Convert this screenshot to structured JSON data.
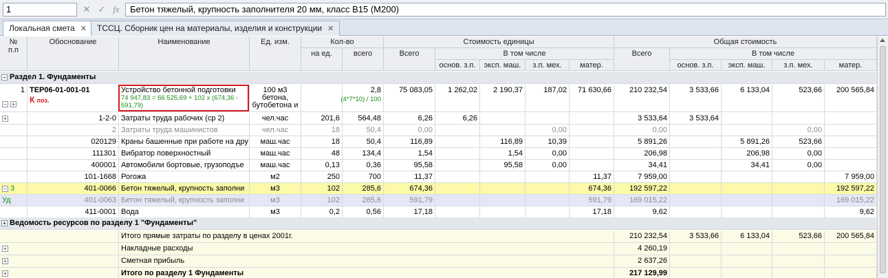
{
  "formula_bar": {
    "cell_ref": "1",
    "cancel_icon": "cancel-icon",
    "accept_icon": "accept-icon",
    "fx_icon": "fx-icon",
    "fx_label": "fx",
    "value": "Бетон тяжелый, крупность заполнителя 20 мм, класс В15 (М200)"
  },
  "tabs": [
    {
      "label": "Локальная смета",
      "close": "✕"
    },
    {
      "label": "ТССЦ. Сборник цен на материалы, изделия и конструкции",
      "close": "✕"
    }
  ],
  "headers": {
    "num": "№",
    "num2": "п.п",
    "basis": "Обоснование",
    "name": "Наименование",
    "unit": "Ед. изм.",
    "qty": "Кол-во",
    "qty_unit": "на ед.",
    "qty_total": "всего",
    "unit_cost": "Стоимость единицы",
    "total": "Всего",
    "incl": "В том числе",
    "osn_zp": "основ. з.п.",
    "eksp_mash": "эксп. маш.",
    "zp_meh": "з.п. мех.",
    "mater": "матер.",
    "total_cost": "Общая стоимость",
    "total2": "Всего",
    "incl2": "В том числе",
    "osn_zp2": "основ. з.п.",
    "eksp_mash2": "эксп. маш.",
    "zp_meh2": "з.п. мех.",
    "mater2": "матер."
  },
  "section1": "Раздел 1. Фундаменты",
  "main_row": {
    "num": "1",
    "code": "ТЕР06-01-001-01",
    "k_label": "К",
    "k_sub": "поз.",
    "name": "Устройство бетонной подготовки",
    "formula": "74 947,83 = 66 525,69 + 102 x (674,36 - 591,79)",
    "unit1": "100 м3",
    "unit2": "бетона,",
    "unit3": "бутобетона и",
    "qty_total": "2,8",
    "qty_formula": "(4*7*10) / 100",
    "u_total": "75 083,05",
    "u_osn": "1 262,02",
    "u_eksp": "2 190,37",
    "u_zpmeh": "187,02",
    "u_mater": "71 630,66",
    "t_total": "210 232,54",
    "t_osn": "3 533,66",
    "t_eksp": "6 133,04",
    "t_zpmeh": "523,66",
    "t_mater": "200 565,84"
  },
  "rows": [
    {
      "type": "plus",
      "bg": "",
      "grey": false,
      "num": "",
      "code": "1-2-0",
      "name": "Затраты труда рабочих (ср 2)",
      "unit": "чел.час",
      "qu": "201,6",
      "qt": "564,48",
      "ut": "6,26",
      "uo": "6,26",
      "ue": "",
      "uz": "",
      "um": "",
      "tt": "3 533,64",
      "to": "3 533,64",
      "te": "",
      "tz": "",
      "tm": ""
    },
    {
      "type": "",
      "bg": "",
      "grey": true,
      "num": "",
      "code": "2",
      "name": "Затраты труда машинистов",
      "unit": "чел.час",
      "qu": "18",
      "qt": "50,4",
      "ut": "0,00",
      "uo": "",
      "ue": "",
      "uz": "0,00",
      "um": "",
      "tt": "0,00",
      "to": "",
      "te": "",
      "tz": "0,00",
      "tm": ""
    },
    {
      "type": "",
      "bg": "",
      "grey": false,
      "num": "",
      "code": "020129",
      "name": "Краны башенные при работе на дру",
      "unit": "маш.час",
      "qu": "18",
      "qt": "50,4",
      "ut": "116,89",
      "uo": "",
      "ue": "116,89",
      "uz": "10,39",
      "um": "",
      "tt": "5 891,26",
      "to": "",
      "te": "5 891,26",
      "tz": "523,66",
      "tm": ""
    },
    {
      "type": "",
      "bg": "",
      "grey": false,
      "num": "",
      "code": "111301",
      "name": "Вибратор поверхностный",
      "unit": "маш.час",
      "qu": "48",
      "qt": "134,4",
      "ut": "1,54",
      "uo": "",
      "ue": "1,54",
      "uz": "0,00",
      "um": "",
      "tt": "206,98",
      "to": "",
      "te": "206,98",
      "tz": "0,00",
      "tm": ""
    },
    {
      "type": "",
      "bg": "",
      "grey": false,
      "num": "",
      "code": "400001",
      "name": "Автомобили бортовые, грузоподъе",
      "unit": "маш.час",
      "qu": "0,13",
      "qt": "0,36",
      "ut": "95,58",
      "uo": "",
      "ue": "95,58",
      "uz": "0,00",
      "um": "",
      "tt": "34,41",
      "to": "",
      "te": "34,41",
      "tz": "0,00",
      "tm": ""
    },
    {
      "type": "",
      "bg": "",
      "grey": false,
      "num": "",
      "code": "101-1668",
      "name": "Рогожа",
      "unit": "м2",
      "qu": "250",
      "qt": "700",
      "ut": "11,37",
      "uo": "",
      "ue": "",
      "uz": "",
      "um": "11,37",
      "tt": "7 959,00",
      "to": "",
      "te": "",
      "tz": "",
      "tm": "7 959,00"
    },
    {
      "type": "minus",
      "bg": "hl",
      "grey": false,
      "num": "3",
      "code": "401-0066",
      "name": "Бетон тяжелый, крупность заполни",
      "unit": "м3",
      "qu": "102",
      "qt": "285,6",
      "ut": "674,36",
      "uo": "",
      "ue": "",
      "uz": "",
      "um": "674,36",
      "tt": "192 597,22",
      "to": "",
      "te": "",
      "tz": "",
      "tm": "192 597,22"
    },
    {
      "type": "",
      "bg": "lav",
      "grey": true,
      "num": "Уд",
      "code": "401-0063",
      "name": "Бетон тяжелый, крупность заполни",
      "unit": "м3",
      "qu": "102",
      "qt": "285,6",
      "ut": "591,79",
      "uo": "",
      "ue": "",
      "uz": "",
      "um": "591,79",
      "tt": "169 015,22",
      "to": "",
      "te": "",
      "tz": "",
      "tm": "169 015,22"
    },
    {
      "type": "",
      "bg": "",
      "grey": false,
      "num": "",
      "code": "411-0001",
      "name": "Вода",
      "unit": "м3",
      "qu": "0,2",
      "qt": "0,56",
      "ut": "17,18",
      "uo": "",
      "ue": "",
      "uz": "",
      "um": "17,18",
      "tt": "9,62",
      "to": "",
      "te": "",
      "tz": "",
      "tm": "9,62"
    }
  ],
  "section2": "Ведомость ресурсов по разделу 1 \"Фундаменты\"",
  "totals": [
    {
      "pm": false,
      "bold": false,
      "label": "Итого прямые затраты по разделу в ценах 2001г.",
      "tt": "210 232,54",
      "to": "3 533,66",
      "te": "6 133,04",
      "tz": "523,66",
      "tm": "200 565,84"
    },
    {
      "pm": true,
      "bold": false,
      "label": "Накладные расходы",
      "tt": "4 260,19",
      "to": "",
      "te": "",
      "tz": "",
      "tm": ""
    },
    {
      "pm": true,
      "bold": false,
      "label": "Сметная прибыль",
      "tt": "2 637,26",
      "to": "",
      "te": "",
      "tz": "",
      "tm": ""
    },
    {
      "pm": true,
      "bold": true,
      "label": "Итого по разделу 1 Фундаменты",
      "tt": "217 129,99",
      "to": "",
      "te": "",
      "tz": "",
      "tm": ""
    }
  ]
}
